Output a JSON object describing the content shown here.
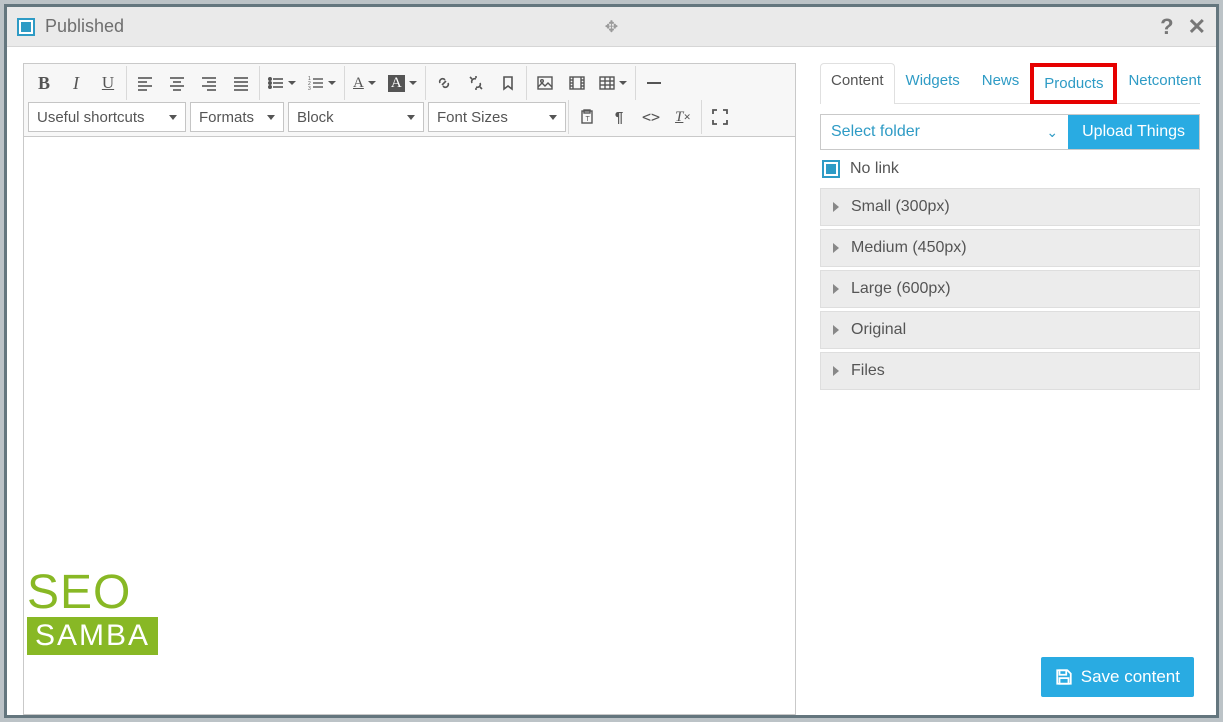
{
  "title": "Published",
  "toolbar": {
    "shortcuts": "Useful shortcuts",
    "formats": "Formats",
    "block": "Block",
    "fontSizes": "Font Sizes"
  },
  "tabs": [
    "Content",
    "Widgets",
    "News",
    "Products",
    "Netcontent"
  ],
  "activeTab": 0,
  "highlightedTab": 3,
  "folder": {
    "placeholder": "Select folder",
    "uploadLabel": "Upload Things"
  },
  "noLink": "No link",
  "accordion": [
    "Small (300px)",
    "Medium (450px)",
    "Large (600px)",
    "Original",
    "Files"
  ],
  "logo": {
    "top": "SEO",
    "bottom": "SAMBA"
  },
  "saveLabel": "Save content"
}
